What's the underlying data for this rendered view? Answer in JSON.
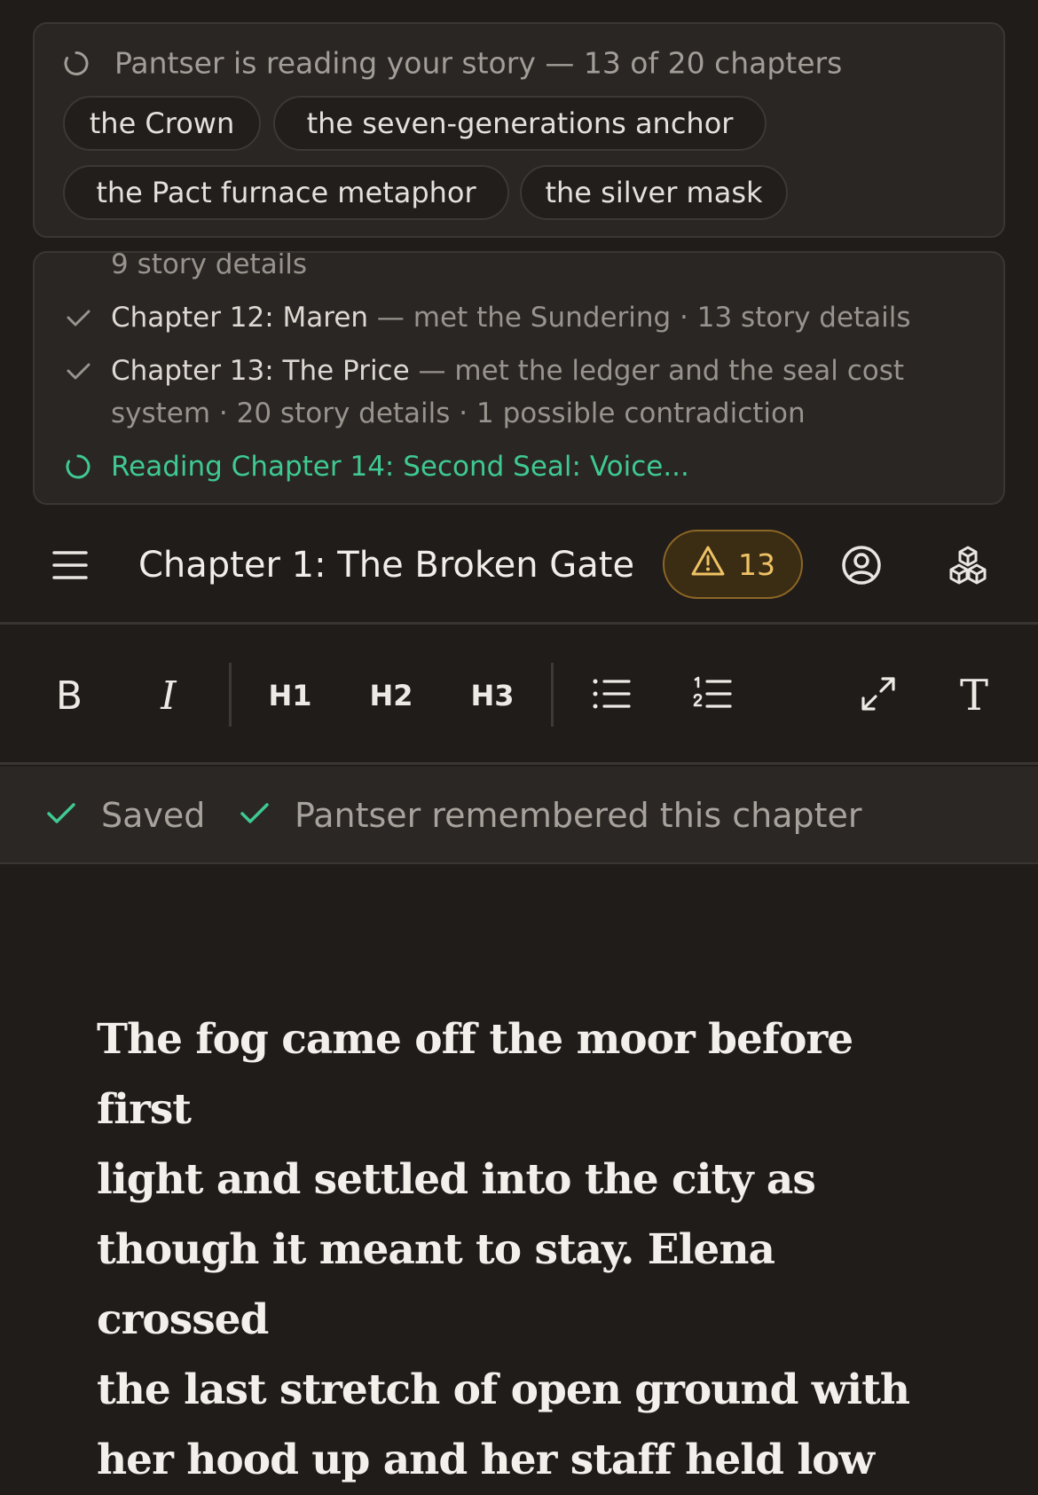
{
  "progress": {
    "status_text": "Pantser is reading your story — 13 of 20 chapters",
    "chips": [
      "the Crown",
      "the seven-generations anchor",
      "the Pact furnace metaphor",
      "the silver mask"
    ]
  },
  "log": {
    "partial_line": "9 story details",
    "entries": [
      {
        "title": "Chapter 12: Maren",
        "detail": " — met the Sundering · 13 story details"
      },
      {
        "title": "Chapter 13: The Price",
        "detail": " — met the ledger and the seal cost",
        "detail_cont": "system · 20 story details · 1 possible contradiction"
      }
    ],
    "reading": "Reading Chapter 14: Second Seal: Voice..."
  },
  "header": {
    "chapter_title": "Chapter 1: The Broken Gate",
    "warning_count": "13",
    "icons": [
      "menu-icon",
      "warning-icon",
      "profile-icon",
      "cubes-icon"
    ]
  },
  "toolbar": {
    "bold": "B",
    "italic": "I",
    "h1": "H1",
    "h2": "H2",
    "h3": "H3",
    "text_style": "T"
  },
  "status": {
    "saved": "Saved",
    "remembered": "Pantser remembered this chapter",
    "accent": "#3fc991"
  },
  "editor": {
    "lines": [
      "The fog came off the moor before first",
      "light and settled into the city as",
      "though it meant to stay. Elena crossed",
      "the last stretch of open ground with",
      "her hood up and her staff held low"
    ]
  }
}
